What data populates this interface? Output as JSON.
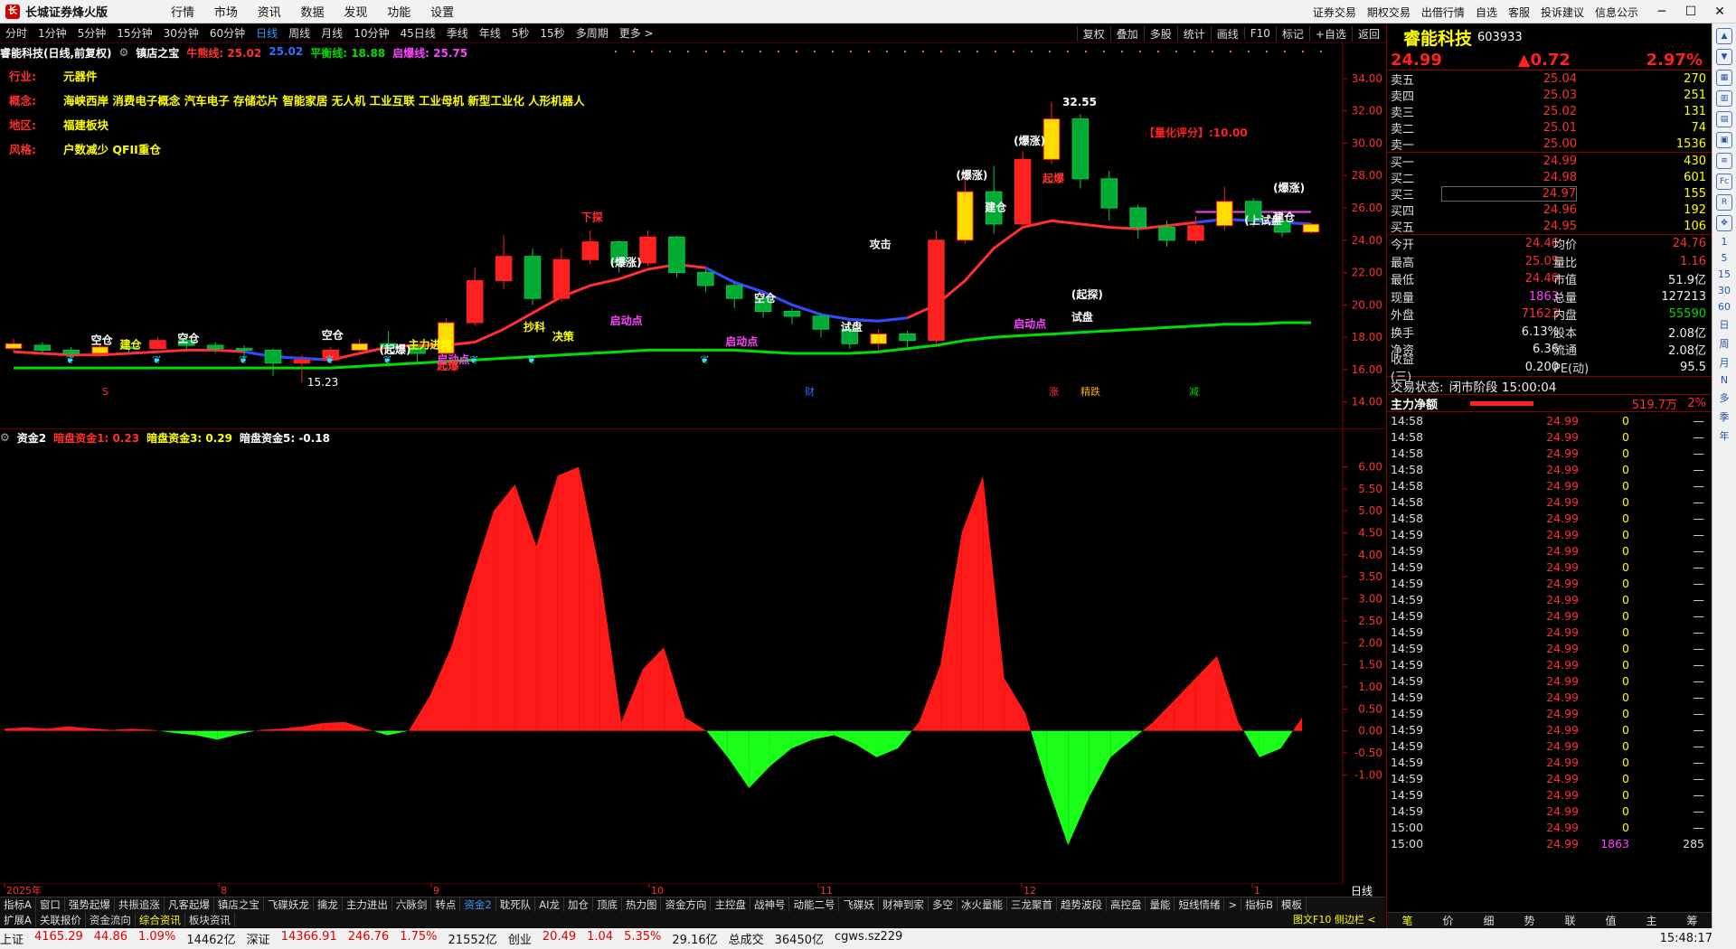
{
  "app": {
    "title": "长城证券烽火版",
    "menu": [
      "行情",
      "市场",
      "资讯",
      "数据",
      "发现",
      "功能",
      "设置"
    ],
    "right_links": [
      "证券交易",
      "期权交易",
      "出借行情",
      "自选",
      "客服",
      "投诉建议",
      "信息公示"
    ]
  },
  "period_bar": {
    "items": [
      "分时",
      "1分钟",
      "5分钟",
      "15分钟",
      "30分钟",
      "60分钟",
      "日线",
      "周线",
      "月线",
      "10分钟",
      "45日线",
      "季线",
      "年线",
      "5秒",
      "15秒",
      "多周期",
      "更多 >"
    ],
    "active": "日线",
    "tools": [
      "复权",
      "叠加",
      "多股",
      "统计",
      "画线",
      "F10",
      "标记",
      "+自选",
      "返回"
    ]
  },
  "main_header": {
    "stock": "睿能科技(日线,前复权)",
    "indicator": "镇店之宝",
    "items": [
      {
        "label": "牛熊线: 25.02",
        "color": "#ff3030"
      },
      {
        "label": "25.02",
        "color": "#3a6bff"
      },
      {
        "label": "平衡线: 18.88",
        "color": "#00dd00"
      },
      {
        "label": "启爆线: 25.75",
        "color": "#ff44ff"
      }
    ]
  },
  "info_panel": [
    {
      "key": "行业:",
      "value": "元器件"
    },
    {
      "key": "概念:",
      "value": "海峡西岸 消费电子概念 汽车电子 存储芯片 智能家居 无人机 工业互联 工业母机 新型工业化 人形机器人"
    },
    {
      "key": "地区:",
      "value": "福建板块"
    },
    {
      "key": "风格:",
      "value": "户数减少 QFII重仓"
    }
  ],
  "main_annotations": {
    "quant_score": "【量化评分】:10.00",
    "high_label": "32.55",
    "low_label": "15.23",
    "markers": [
      "财",
      "涨",
      "精跌",
      "减",
      "S"
    ],
    "labels": [
      {
        "text": "空仓",
        "color": "#ffffff"
      },
      {
        "text": "空仓",
        "color": "#ffffff"
      },
      {
        "text": "空仓",
        "color": "#ffffff"
      },
      {
        "text": "空仓",
        "color": "#ffffff"
      },
      {
        "text": "建仓",
        "color": "#ffffff"
      },
      {
        "text": "建仓",
        "color": "#ffffff"
      },
      {
        "text": "试盘",
        "color": "#ffffff"
      },
      {
        "text": "试盘",
        "color": "#ffffff"
      },
      {
        "text": "(上试盘",
        "color": "#ffffff"
      },
      {
        "text": "攻击",
        "color": "#ffffff"
      },
      {
        "text": "(爆涨)",
        "color": "#ffffff"
      },
      {
        "text": "(爆涨)",
        "color": "#ffffff"
      },
      {
        "text": "(爆涨)",
        "color": "#ffffff"
      },
      {
        "text": "(爆涨)",
        "color": "#ffffff"
      },
      {
        "text": "(起爆)",
        "color": "#ffffff"
      },
      {
        "text": "启动点",
        "color": "#ff44ff"
      },
      {
        "text": "启动点",
        "color": "#ff44ff"
      },
      {
        "text": "启动点",
        "color": "#ff44ff"
      },
      {
        "text": "启动点",
        "color": "#ff44ff"
      },
      {
        "text": "起爆",
        "color": "#ff3030"
      },
      {
        "text": "起爆",
        "color": "#ff3030"
      },
      {
        "text": "下探",
        "color": "#ff3030"
      },
      {
        "text": "(起探)",
        "color": "#ffffff"
      },
      {
        "text": "抄科",
        "color": "#ffff00"
      },
      {
        "text": "决策",
        "color": "#ffff00"
      },
      {
        "text": "建仓",
        "color": "#ffff00"
      },
      {
        "text": "主力进场",
        "color": "#ffff00"
      }
    ]
  },
  "sub_header": {
    "name": "资金2",
    "items": [
      {
        "label": "暗盘资金1: 0.23",
        "color": "#ff3030"
      },
      {
        "label": "暗盘资金3: 0.29",
        "color": "#ffff00"
      },
      {
        "label": "暗盘资金5: -0.18",
        "color": "#ffffff"
      }
    ]
  },
  "chart_data": [
    {
      "type": "line",
      "title": "睿能科技(日线,前复权) 镇店之宝",
      "y_ticks": [
        34.0,
        32.0,
        30.0,
        28.0,
        26.0,
        24.0,
        22.0,
        20.0,
        18.0,
        16.0,
        14.0
      ],
      "ylim": [
        13.2,
        35.0
      ],
      "series": [
        {
          "name": "牛熊线",
          "color": "#ff3030",
          "values": [
            17.1,
            17.0,
            16.9,
            16.9,
            17.0,
            17.1,
            17.2,
            17.2,
            17.1,
            16.8,
            16.7,
            16.6,
            17.0,
            17.4,
            17.5,
            17.5,
            17.7,
            18.5,
            19.5,
            20.5,
            21.2,
            21.6,
            22.2,
            22.5,
            22.3,
            21.4,
            20.8,
            20.0,
            19.4,
            19.1,
            19.0,
            19.2,
            20.0,
            21.5,
            23.5,
            24.8,
            25.2,
            25.0,
            24.8,
            24.7,
            24.9,
            25.1,
            25.3,
            25.2,
            25.1,
            25.0
          ]
        },
        {
          "name": "平衡线",
          "color": "#00dd00",
          "values": [
            16.1,
            16.1,
            16.1,
            16.1,
            16.1,
            16.1,
            16.1,
            16.1,
            16.1,
            16.1,
            16.1,
            16.1,
            16.2,
            16.3,
            16.4,
            16.5,
            16.6,
            16.7,
            16.8,
            16.9,
            17.0,
            17.1,
            17.2,
            17.2,
            17.2,
            17.2,
            17.1,
            17.0,
            17.0,
            17.0,
            17.1,
            17.3,
            17.5,
            17.8,
            18.0,
            18.1,
            18.2,
            18.3,
            18.4,
            18.5,
            18.6,
            18.7,
            18.8,
            18.8,
            18.9,
            18.9
          ]
        },
        {
          "name": "启爆线",
          "color": "#ff44ff",
          "values": [
            25.75,
            25.75
          ]
        }
      ],
      "candles": [
        [
          17.3,
          17.6,
          17.9,
          17.1
        ],
        [
          17.5,
          17.2,
          17.7,
          17.0
        ],
        [
          17.2,
          17.0,
          17.4,
          16.8
        ],
        [
          17.0,
          17.4,
          17.6,
          16.9
        ],
        [
          17.4,
          17.3,
          17.7,
          17.1
        ],
        [
          17.3,
          17.8,
          18.0,
          17.2
        ],
        [
          17.8,
          17.5,
          18.0,
          17.3
        ],
        [
          17.5,
          17.3,
          17.7,
          17.0
        ],
        [
          17.3,
          17.2,
          17.5,
          16.6
        ],
        [
          17.2,
          16.4,
          17.3,
          15.6
        ],
        [
          16.4,
          16.6,
          16.9,
          15.2
        ],
        [
          16.6,
          17.2,
          17.4,
          16.4
        ],
        [
          17.2,
          17.6,
          17.9,
          17.0
        ],
        [
          17.6,
          17.4,
          18.4,
          17.2
        ],
        [
          17.4,
          17.0,
          17.6,
          16.5
        ],
        [
          17.0,
          18.9,
          19.2,
          16.8
        ],
        [
          18.9,
          21.5,
          22.3,
          18.7
        ],
        [
          21.5,
          23.0,
          24.3,
          21.0
        ],
        [
          23.0,
          20.4,
          23.5,
          20.0
        ],
        [
          20.4,
          22.8,
          23.5,
          20.2
        ],
        [
          22.8,
          23.9,
          24.6,
          22.5
        ],
        [
          23.9,
          22.6,
          24.0,
          22.0
        ],
        [
          22.6,
          24.2,
          24.6,
          22.4
        ],
        [
          24.2,
          22.0,
          24.3,
          21.7
        ],
        [
          22.0,
          21.2,
          22.2,
          20.8
        ],
        [
          21.2,
          20.4,
          21.4,
          19.8
        ],
        [
          20.4,
          19.6,
          20.6,
          19.2
        ],
        [
          19.6,
          19.3,
          19.8,
          18.8
        ],
        [
          19.3,
          18.5,
          19.5,
          18.0
        ],
        [
          18.5,
          17.6,
          18.7,
          17.3
        ],
        [
          17.6,
          18.2,
          18.5,
          17.2
        ],
        [
          18.2,
          17.8,
          18.4,
          17.4
        ],
        [
          17.8,
          24.0,
          24.6,
          17.6
        ],
        [
          24.0,
          27.0,
          28.2,
          23.8
        ],
        [
          27.0,
          25.0,
          28.6,
          24.4
        ],
        [
          25.0,
          29.0,
          29.5,
          24.8
        ],
        [
          29.0,
          31.5,
          32.55,
          28.7
        ],
        [
          31.5,
          27.8,
          31.8,
          27.2
        ],
        [
          27.8,
          26.0,
          28.3,
          25.2
        ],
        [
          26.0,
          24.8,
          26.2,
          24.1
        ],
        [
          24.8,
          24.0,
          25.2,
          23.6
        ],
        [
          24.0,
          24.9,
          25.5,
          23.8
        ],
        [
          24.9,
          26.4,
          27.3,
          24.6
        ],
        [
          26.4,
          25.2,
          26.6,
          24.8
        ],
        [
          25.2,
          24.5,
          25.6,
          24.2
        ],
        [
          24.5,
          24.99,
          25.05,
          24.4
        ]
      ],
      "candle_format": "[open, close, high, low]"
    },
    {
      "type": "area",
      "title": "资金2",
      "y_ticks": [
        6.0,
        5.5,
        5.0,
        4.5,
        4.0,
        3.5,
        3.0,
        2.5,
        2.0,
        1.5,
        1.0,
        0.5,
        0.0,
        -0.5,
        -1.0
      ],
      "ylim": [
        -2.8,
        6.4
      ],
      "values": [
        0.05,
        0.08,
        0.05,
        0.1,
        0.06,
        0.02,
        0.05,
        0.02,
        -0.05,
        -0.1,
        -0.2,
        -0.08,
        0.02,
        0.05,
        0.1,
        0.18,
        0.2,
        0.05,
        -0.1,
        0.0,
        0.8,
        1.9,
        3.5,
        5.0,
        5.6,
        4.2,
        5.8,
        6.0,
        3.6,
        0.2,
        1.4,
        1.9,
        0.3,
        0.0,
        -0.6,
        -1.3,
        -0.8,
        -0.4,
        -0.2,
        -0.1,
        -0.3,
        -0.6,
        -0.4,
        0.2,
        1.5,
        4.5,
        5.8,
        1.2,
        0.4,
        -1.2,
        -2.6,
        -1.5,
        -0.6,
        -0.2,
        0.2,
        0.7,
        1.2,
        1.7,
        0.2,
        -0.6,
        -0.4,
        0.3
      ]
    }
  ],
  "x_axis_labels": [
    "2025年",
    "8",
    "9",
    "10",
    "11",
    "12",
    "1"
  ],
  "x_axis_right": "日线",
  "quote": {
    "name": "睿能科技",
    "code": "603933",
    "price": "24.99",
    "change": "▲0.72",
    "change_pct": "2.97%",
    "sell": [
      {
        "label": "卖五",
        "price": "25.04",
        "vol": "270"
      },
      {
        "label": "卖四",
        "price": "25.03",
        "vol": "251"
      },
      {
        "label": "卖三",
        "price": "25.02",
        "vol": "131"
      },
      {
        "label": "卖二",
        "price": "25.01",
        "vol": "74"
      },
      {
        "label": "卖一",
        "price": "25.00",
        "vol": "1536"
      }
    ],
    "buy": [
      {
        "label": "买一",
        "price": "24.99",
        "vol": "430"
      },
      {
        "label": "买二",
        "price": "24.98",
        "vol": "601"
      },
      {
        "label": "买三",
        "price": "24.97",
        "vol": "155"
      },
      {
        "label": "买四",
        "price": "24.96",
        "vol": "192"
      },
      {
        "label": "买五",
        "price": "24.95",
        "vol": "106"
      }
    ],
    "stats": [
      {
        "k1": "今开",
        "v1": "24.46",
        "c1": "red",
        "k2": "均价",
        "v2": "24.76",
        "c2": "red"
      },
      {
        "k1": "最高",
        "v1": "25.05",
        "c1": "red",
        "k2": "量比",
        "v2": "1.16",
        "c2": "red"
      },
      {
        "k1": "最低",
        "v1": "24.40",
        "c1": "red",
        "k2": "市值",
        "v2": "51.9亿",
        "c2": "wht"
      },
      {
        "k1": "现量",
        "v1": "1863",
        "c1": "mag",
        "k2": "总量",
        "v2": "127213",
        "c2": "wht"
      },
      {
        "k1": "外盘",
        "v1": "71623",
        "c1": "red",
        "k2": "内盘",
        "v2": "55590",
        "c2": "grn"
      },
      {
        "k1": "换手",
        "v1": "6.13%",
        "c1": "wht",
        "k2": "股本",
        "v2": "2.08亿",
        "c2": "wht"
      },
      {
        "k1": "净资",
        "v1": "6.36",
        "c1": "wht",
        "k2": "流通",
        "v2": "2.08亿",
        "c2": "wht"
      },
      {
        "k1": "收益(三)",
        "v1": "0.200",
        "c1": "wht",
        "k2": "PE(动)",
        "v2": "95.5",
        "c2": "wht"
      }
    ],
    "trade_status_label": "交易状态:",
    "trade_status": "闭市阶段 15:00:04",
    "main_flow_label": "主力净额",
    "main_flow_value": "519.7万",
    "main_flow_pct": "2%",
    "ticks": [
      {
        "t": "14:58",
        "p": "24.99",
        "v": "0"
      },
      {
        "t": "14:58",
        "p": "24.99",
        "v": "0"
      },
      {
        "t": "14:58",
        "p": "24.99",
        "v": "0"
      },
      {
        "t": "14:58",
        "p": "24.99",
        "v": "0"
      },
      {
        "t": "14:58",
        "p": "24.99",
        "v": "0"
      },
      {
        "t": "14:58",
        "p": "24.99",
        "v": "0"
      },
      {
        "t": "14:58",
        "p": "24.99",
        "v": "0"
      },
      {
        "t": "14:59",
        "p": "24.99",
        "v": "0"
      },
      {
        "t": "14:59",
        "p": "24.99",
        "v": "0"
      },
      {
        "t": "14:59",
        "p": "24.99",
        "v": "0"
      },
      {
        "t": "14:59",
        "p": "24.99",
        "v": "0"
      },
      {
        "t": "14:59",
        "p": "24.99",
        "v": "0"
      },
      {
        "t": "14:59",
        "p": "24.99",
        "v": "0"
      },
      {
        "t": "14:59",
        "p": "24.99",
        "v": "0"
      },
      {
        "t": "14:59",
        "p": "24.99",
        "v": "0"
      },
      {
        "t": "14:59",
        "p": "24.99",
        "v": "0"
      },
      {
        "t": "14:59",
        "p": "24.99",
        "v": "0"
      },
      {
        "t": "14:59",
        "p": "24.99",
        "v": "0"
      },
      {
        "t": "14:59",
        "p": "24.99",
        "v": "0"
      },
      {
        "t": "14:59",
        "p": "24.99",
        "v": "0"
      },
      {
        "t": "14:59",
        "p": "24.99",
        "v": "0"
      },
      {
        "t": "14:59",
        "p": "24.99",
        "v": "0"
      },
      {
        "t": "14:59",
        "p": "24.99",
        "v": "0"
      },
      {
        "t": "14:59",
        "p": "24.99",
        "v": "0"
      },
      {
        "t": "14:59",
        "p": "24.99",
        "v": "0"
      },
      {
        "t": "15:00",
        "p": "24.99",
        "v": "0"
      },
      {
        "t": "15:00",
        "p": "24.99",
        "v": "1863",
        "n": "285"
      }
    ],
    "tick_dash": "—",
    "tabs": [
      "笔",
      "价",
      "细",
      "势",
      "联",
      "值",
      "主",
      "筹"
    ],
    "active_tab": "笔"
  },
  "bottom_tabs": {
    "row1": [
      "指标A",
      "窗口",
      "强势起爆",
      "共振追涨",
      "凡客起爆",
      "镇店之宝",
      "飞碟妖龙",
      "擒龙",
      "主力进出",
      "六脉剑",
      "转点",
      "资金2",
      "耽死队",
      "AI龙",
      "加仓",
      "顶底",
      "热力图",
      "资金方向",
      "主控盘",
      "战神号",
      "动能二号",
      "飞碟妖",
      "财神到家",
      "多空",
      "冰火量能",
      "三龙聚首",
      "趋势波段",
      "高控盘",
      "量能",
      "短线情绪",
      ">",
      "指标B",
      "模板"
    ],
    "row1_active": "资金2",
    "row2": [
      "扩展A",
      "关联报价",
      "资金流向",
      "综合资讯",
      "板块资讯"
    ],
    "row2_active": "综合资讯",
    "f10_link": "图文F10 侧边栏 <"
  },
  "statusbar": {
    "items": [
      {
        "text": "上证",
        "c": "blk"
      },
      {
        "text": "4165.29",
        "c": "red"
      },
      {
        "text": "44.86",
        "c": "red"
      },
      {
        "text": "1.09%",
        "c": "red"
      },
      {
        "text": "14462亿",
        "c": "blk"
      },
      {
        "text": "深证",
        "c": "blk"
      },
      {
        "text": "14366.91",
        "c": "red"
      },
      {
        "text": "246.76",
        "c": "red"
      },
      {
        "text": "1.75%",
        "c": "red"
      },
      {
        "text": "21552亿",
        "c": "blk"
      },
      {
        "text": "创业",
        "c": "blk"
      },
      {
        "text": "20.49",
        "c": "red"
      },
      {
        "text": "1.04",
        "c": "red"
      },
      {
        "text": "5.35%",
        "c": "red"
      },
      {
        "text": "29.16亿",
        "c": "blk"
      },
      {
        "text": "总成交",
        "c": "blk"
      },
      {
        "text": "36450亿",
        "c": "blk"
      },
      {
        "text": "cgws.sz229",
        "c": "blk"
      }
    ],
    "time": "15:48:17"
  },
  "side_strip": {
    "icons": [
      "expand-icon",
      "collapse-icon",
      "chart-icon",
      "bar-icon",
      "grid-icon",
      "tv-icon",
      "list-icon",
      "fc-icon",
      "rsi-icon",
      "settings-icon"
    ],
    "texts": [
      "1",
      "5",
      "15",
      "30",
      "60",
      "日",
      "周",
      "月",
      "N",
      "多",
      "季",
      "年"
    ]
  }
}
